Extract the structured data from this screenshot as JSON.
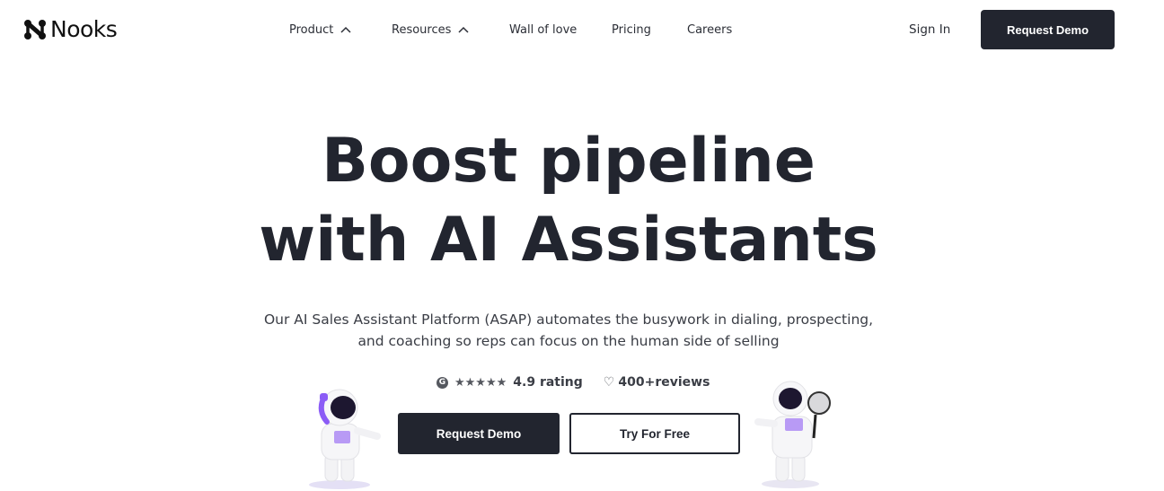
{
  "header": {
    "brand": "Nooks",
    "nav": [
      {
        "label": "Product",
        "has_dropdown": true
      },
      {
        "label": "Resources",
        "has_dropdown": true
      },
      {
        "label": "Wall of love",
        "has_dropdown": false
      },
      {
        "label": "Pricing",
        "has_dropdown": false
      },
      {
        "label": "Careers",
        "has_dropdown": false
      }
    ],
    "sign_in": "Sign In",
    "cta": "Request Demo"
  },
  "hero": {
    "headline_line1": "Boost pipeline",
    "headline_line2": "with AI Assistants",
    "subtitle_line1": "Our AI Sales Assistant Platform (ASAP) automates the busywork in dialing, prospecting,",
    "subtitle_line2": "and coaching so reps can focus on the human side of selling",
    "rating": {
      "source_icon": "g2-icon",
      "stars_glyph": "★★★★★",
      "stars": 5,
      "text": "4.9 rating",
      "heart_glyph": "♡",
      "reviews": "400+reviews"
    },
    "primary_cta": "Request Demo",
    "secondary_cta": "Try For Free",
    "illustrations": [
      "astronaut-phone",
      "astronaut-magnifier"
    ]
  },
  "colors": {
    "dark": "#22252f",
    "text": "#3a3d45",
    "accent_purple": "#8b5cf6",
    "white": "#ffffff"
  }
}
